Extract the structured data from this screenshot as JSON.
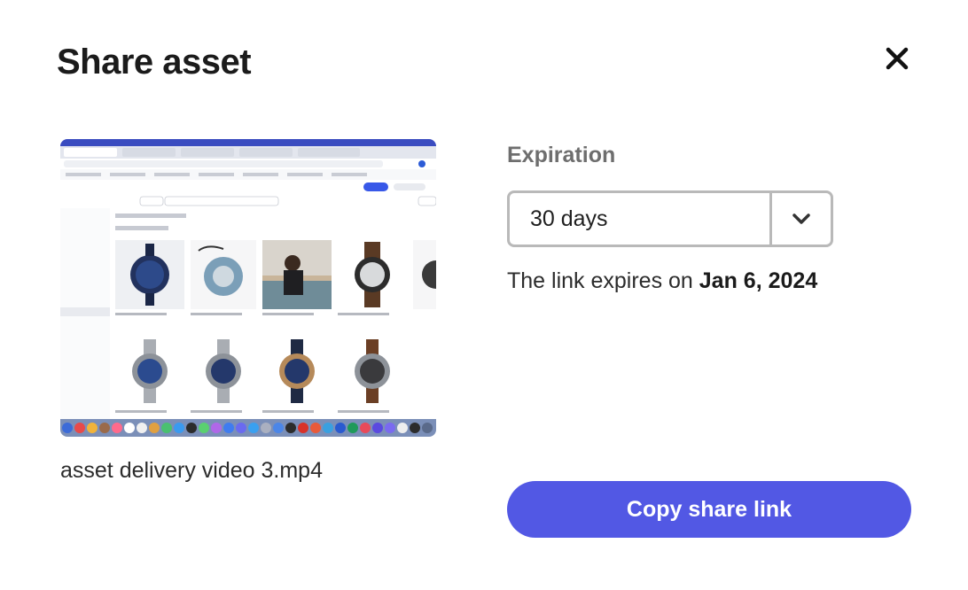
{
  "dialog": {
    "title": "Share asset",
    "close_icon": "close-icon"
  },
  "asset": {
    "thumbnail_icon": "video-thumbnail",
    "filename": "asset delivery video 3.mp4"
  },
  "expiration": {
    "label": "Expiration",
    "selected_value": "30 days",
    "dropdown_icon": "chevron-down-icon",
    "note_prefix": "The link expires on",
    "expiry_date": "Jan 6, 2024"
  },
  "actions": {
    "copy_link_label": "Copy share link"
  },
  "colors": {
    "primary_button": "#5258e4",
    "label_gray": "#6e6e6e",
    "border_gray": "#b9b9b9"
  }
}
